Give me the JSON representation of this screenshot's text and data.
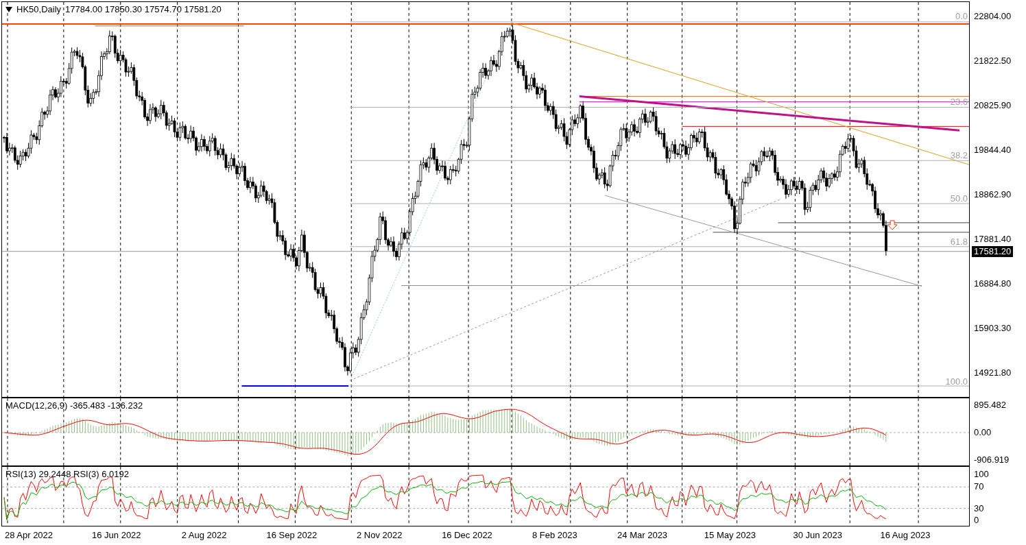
{
  "header": {
    "symbol": "HK50,Daily",
    "ohlc": "17784.00 17850.30 17574.70 17581.20"
  },
  "price_axis": [
    "22804.00",
    "21822.50",
    "20825.90",
    "19844.40",
    "18862.90",
    "17881.40",
    "16884.80",
    "15903.30",
    "14921.80"
  ],
  "current_price": "17581.20",
  "fib_levels": [
    {
      "label": "0.0"
    },
    {
      "label": "23.6"
    },
    {
      "label": "38.2"
    },
    {
      "label": "50.0"
    },
    {
      "label": "61.8"
    },
    {
      "label": "100.0"
    }
  ],
  "macd": {
    "title": "MACD(12,26,9) -365.483 -136.232",
    "axis": [
      "895.482",
      "0.00",
      "-906.919"
    ]
  },
  "rsi": {
    "title": "RSI(13) 29.2448  RSI(3) 6.0192",
    "axis": [
      "100",
      "70",
      "30",
      "0"
    ]
  },
  "dates": [
    "28 Apr 2022",
    "16 Jun 2022",
    "2 Aug 2022",
    "16 Sep 2022",
    "2 Nov 2022",
    "16 Dec 2022",
    "8 Feb 2023",
    "24 Mar 2023",
    "15 May 2023",
    "30 Jun 2023",
    "16 Aug 2023"
  ]
}
